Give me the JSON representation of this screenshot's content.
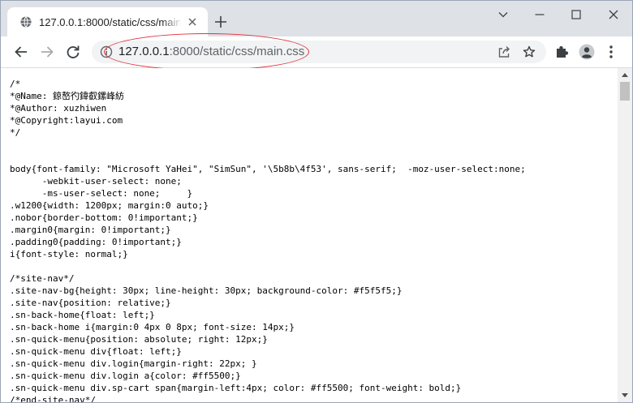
{
  "browser": {
    "tab_title": "127.0.0.1:8000/static/css/main.css",
    "url_host": "127.0.0.1",
    "url_rest": ":8000/static/css/main.css"
  },
  "colors": {
    "annotation": "#e0323c",
    "tabbar": "#dee1e6",
    "omnibox": "#f1f3f4"
  },
  "icons": {
    "favicon": "globe-icon",
    "tab_close": "close-icon",
    "new_tab": "plus-icon",
    "minimize": "chevron-down-icon",
    "maximize": "minimize-window-icon",
    "restore": "maximize-window-icon",
    "close": "close-window-icon",
    "back": "back-arrow-icon",
    "forward": "forward-arrow-icon",
    "reload": "reload-icon",
    "site_info": "info-icon",
    "share": "share-icon",
    "bookmark": "star-icon",
    "extensions": "puzzle-icon",
    "profile": "profile-icon",
    "menu": "kebab-menu-icon"
  },
  "file_content": "/*\n*@Name: 鍄嶅彴鍏叡鏍峰紡\n*@Author: xuzhiwen\n*@Copyright:layui.com\n*/\n\n\nbody{font-family: \"Microsoft YaHei\", \"SimSun\", '\\5b8b\\4f53', sans-serif;  -moz-user-select:none;\n      -webkit-user-select: none;\n      -ms-user-select: none;     }\n.w1200{width: 1200px; margin:0 auto;}\n.nobor{border-bottom: 0!important;}\n.margin0{margin: 0!important;}\n.padding0{padding: 0!important;}\ni{font-style: normal;}\n\n/*site-nav*/\n.site-nav-bg{height: 30px; line-height: 30px; background-color: #f5f5f5;}\n.site-nav{position: relative;}\n.sn-back-home{float: left;}\n.sn-back-home i{margin:0 4px 0 8px; font-size: 14px;}\n.sn-quick-menu{position: absolute; right: 12px;}\n.sn-quick-menu div{float: left;}\n.sn-quick-menu div.login{margin-right: 22px; }\n.sn-quick-menu div.login a{color: #ff5500;}\n.sn-quick-menu div.sp-cart span{margin-left:4px; color: #ff5500; font-weight: bold;}\n/*end-site-nav*/"
}
